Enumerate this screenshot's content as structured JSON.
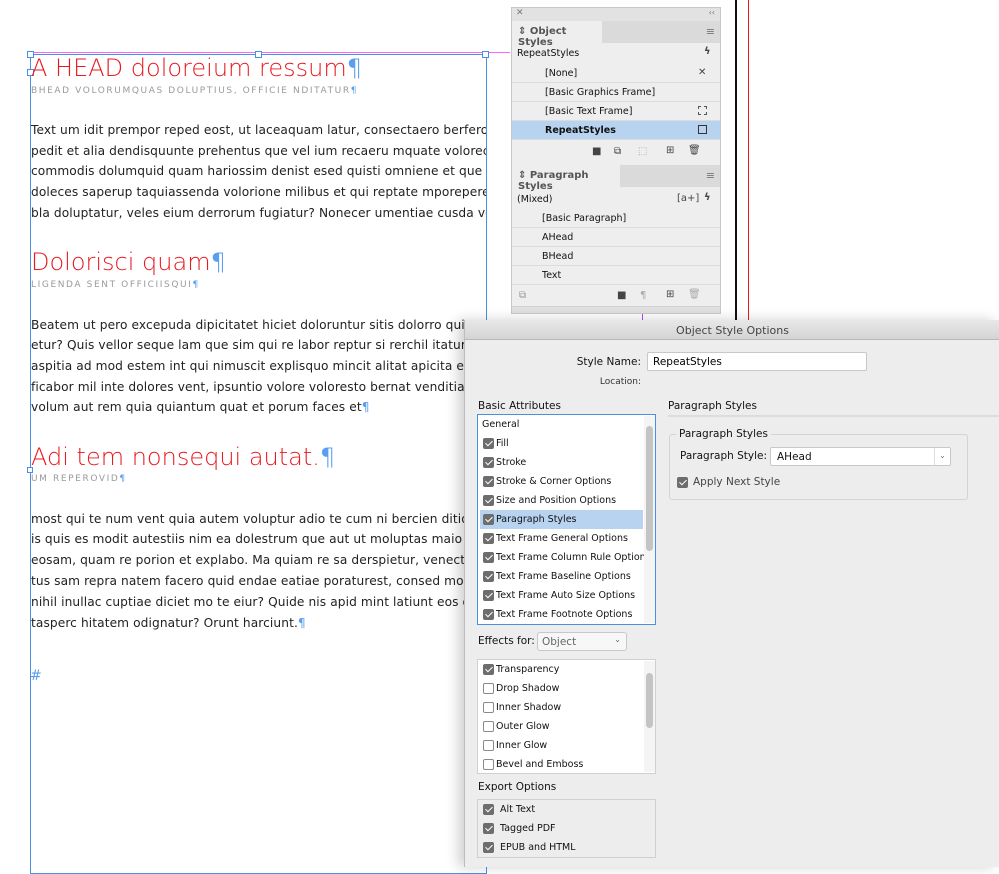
{
  "document": {
    "paragraphs": [
      {
        "type": "ahead",
        "text": "A HEAD doloreium ressum"
      },
      {
        "type": "bhead",
        "text": "BHEAD VOLORUMQUAS DOLUPTIUS, OFFICIE NDITATUR"
      },
      {
        "type": "text",
        "lines": [
          "Text um idit prempor reped eost, ut laceaquam latur, consectaero berfero denim-",
          "pedit et alia dendisquunte prehentus que vel ium recaeru mquate volorecatem",
          "commodis dolumquid quam hariossim denist esed quisti omniene et que rentio",
          "doleces saperup taquiassenda volorione milibus et qui reptate mporeperem volo",
          "bla doluptatur, veles eium derrorum fugiatur? Nonecer umentiae cusda voluptat"
        ]
      },
      {
        "type": "ahead",
        "text": "Dolorisci quam"
      },
      {
        "type": "bhead",
        "text": "LIGENDA SENT OFFICIISQUI"
      },
      {
        "type": "text",
        "lines": [
          "Beatem ut pero excepuda dipicitatet hiciet doloruntur sitis dolorro quiaec",
          "etur? Quis vellor seque lam que sim qui re labor reptur si rerchil itatum quas",
          "aspitia ad mod estem int qui nimuscit explisquo mincit alitat apicita eribus",
          "ficabor mil inte dolores vent, ipsuntio volore voloresto bernat venditiae min",
          "volum aut rem quia quiantum quat et porum faces et"
        ]
      },
      {
        "type": "ahead",
        "text": "Adi tem nonsequi autat."
      },
      {
        "type": "bhead",
        "text": "UM REPEROVID"
      },
      {
        "type": "text",
        "lines": [
          "most qui te num vent quia autem voluptur adio te cum ni bercien ditio. Min",
          "is quis es modit autestiis nim ea dolestrum que aut ut moluptas maio qui au",
          "eosam, quam re porion et explabo. Ma quiam re sa derspietur, venectate vo",
          "tus sam repra natem facero quid endae eatiae poraturest, consed modisqui",
          "nihil inullac cuptiae diciet mo te eiur? Quide nis apid mint latiunt eos dole",
          "tasperc hitatem odignatur? Orunt harciunt."
        ]
      }
    ],
    "pilcrow": "¶",
    "end_marker": "#",
    "head_color": "#e8191f"
  },
  "object_styles_panel": {
    "title": "Object Styles",
    "current": "RepeatStyles",
    "items": [
      "[None]",
      "[Basic Graphics Frame]",
      "[Basic Text Frame]",
      "RepeatStyles"
    ],
    "selected": "RepeatStyles"
  },
  "paragraph_styles_panel": {
    "title": "Paragraph Styles",
    "current": "(Mixed)",
    "new_style_badge": "[a+]",
    "items": [
      "[Basic Paragraph]",
      "AHead",
      "BHead",
      "Text"
    ]
  },
  "dialog": {
    "title": "Object Style Options",
    "style_name_label": "Style Name:",
    "style_name_value": "RepeatStyles",
    "location_label": "Location:",
    "basic_attributes_label": "Basic Attributes",
    "basic_attributes": [
      {
        "label": "General"
      },
      {
        "label": "Fill",
        "checked": true
      },
      {
        "label": "Stroke",
        "checked": true
      },
      {
        "label": "Stroke & Corner Options",
        "checked": true
      },
      {
        "label": "Size and Position Options",
        "checked": true
      },
      {
        "label": "Paragraph Styles",
        "checked": true,
        "selected": true
      },
      {
        "label": "Text Frame General Options",
        "checked": true
      },
      {
        "label": "Text Frame Column Rule Options",
        "checked": true
      },
      {
        "label": "Text Frame Baseline Options",
        "checked": true
      },
      {
        "label": "Text Frame Auto Size Options",
        "checked": true
      },
      {
        "label": "Text Frame Footnote Options",
        "checked": true
      }
    ],
    "effects_for_label": "Effects for:",
    "effects_for_value": "Object",
    "effects": [
      {
        "label": "Transparency",
        "checked": true
      },
      {
        "label": "Drop Shadow",
        "checked": false
      },
      {
        "label": "Inner Shadow",
        "checked": false
      },
      {
        "label": "Outer Glow",
        "checked": false
      },
      {
        "label": "Inner Glow",
        "checked": false
      },
      {
        "label": "Bevel and Emboss",
        "checked": false
      }
    ],
    "export_options_label": "Export Options",
    "export_options": [
      {
        "label": "Alt Text",
        "checked": true
      },
      {
        "label": "Tagged PDF",
        "checked": true
      },
      {
        "label": "EPUB and HTML",
        "checked": true
      }
    ],
    "section_title": "Paragraph Styles",
    "group_title": "Paragraph Styles",
    "paragraph_style_label": "Paragraph Style:",
    "paragraph_style_value": "AHead",
    "apply_next_style_label": "Apply Next Style",
    "apply_next_style_checked": true
  }
}
